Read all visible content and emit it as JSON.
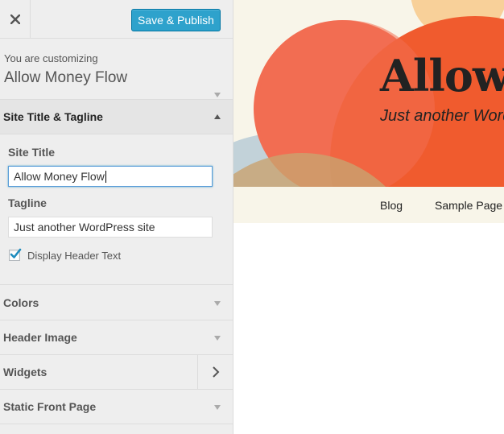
{
  "toolbar": {
    "publish_label": "Save & Publish",
    "close_icon": "close-icon"
  },
  "info": {
    "customizing_label": "You are customizing",
    "site_name": "Allow Money Flow"
  },
  "sections": {
    "title_tagline": {
      "label": "Site Title & Tagline",
      "site_title_label": "Site Title",
      "site_title_value": "Allow Money Flow",
      "tagline_label": "Tagline",
      "tagline_value": "Just another WordPress site",
      "display_header_text_label": "Display Header Text",
      "display_header_text_checked": true
    },
    "colors": {
      "label": "Colors"
    },
    "header_image": {
      "label": "Header Image"
    },
    "widgets": {
      "label": "Widgets"
    },
    "static_front_page": {
      "label": "Static Front Page"
    }
  },
  "preview": {
    "site_title": "Allow Money Flow",
    "tagline": "Just another WordPress site",
    "nav": [
      "Blog",
      "Sample Page"
    ]
  },
  "colors": {
    "accent": "#2ea2cc",
    "header_bg": "#f8f5e9",
    "circle_orange": "#f26d52"
  }
}
